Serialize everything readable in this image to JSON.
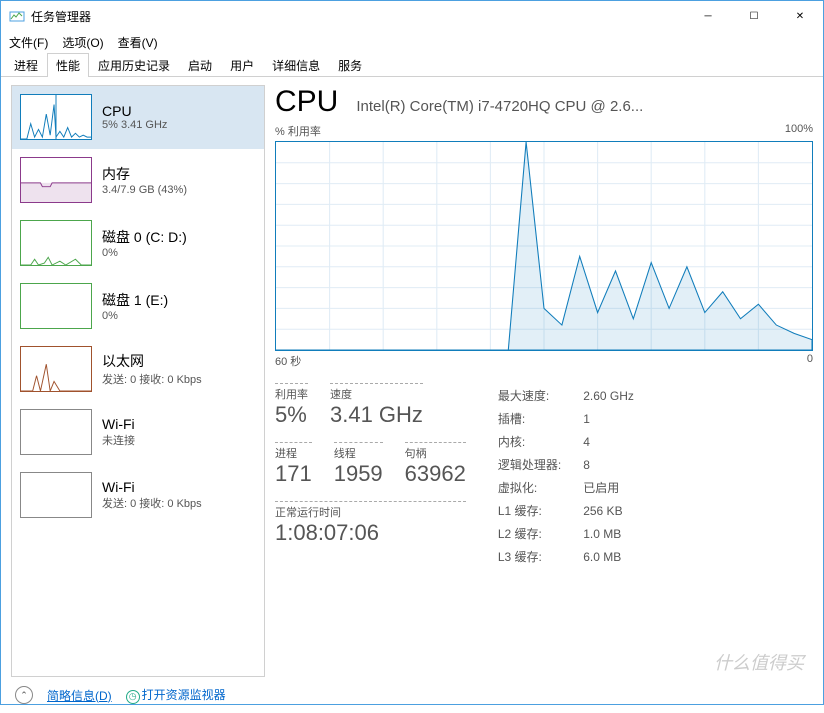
{
  "window": {
    "title": "任务管理器",
    "controls": {
      "min": "─",
      "max": "☐",
      "close": "✕"
    }
  },
  "menu": {
    "file": "文件(F)",
    "options": "选项(O)",
    "view": "查看(V)"
  },
  "tabs": {
    "processes": "进程",
    "performance": "性能",
    "history": "应用历史记录",
    "startup": "启动",
    "users": "用户",
    "details": "详细信息",
    "services": "服务"
  },
  "sidebar": {
    "cpu": {
      "name": "CPU",
      "val": "5%  3.41 GHz"
    },
    "mem": {
      "name": "内存",
      "val": "3.4/7.9 GB (43%)"
    },
    "disk0": {
      "name": "磁盘 0 (C: D:)",
      "val": "0%"
    },
    "disk1": {
      "name": "磁盘 1 (E:)",
      "val": "0%"
    },
    "eth": {
      "name": "以太网",
      "val": "发送: 0 接收: 0 Kbps"
    },
    "wifi1": {
      "name": "Wi-Fi",
      "val": "未连接"
    },
    "wifi2": {
      "name": "Wi-Fi",
      "val": "发送: 0 接收: 0 Kbps"
    }
  },
  "main": {
    "title": "CPU",
    "subtitle": "Intel(R) Core(TM) i7-4720HQ CPU @ 2.6...",
    "util_label": "% 利用率",
    "ymax": "100%",
    "xleft": "60 秒",
    "xright": "0"
  },
  "stats": {
    "util_lbl": "利用率",
    "util_val": "5%",
    "speed_lbl": "速度",
    "speed_val": "3.41 GHz",
    "proc_lbl": "进程",
    "proc_val": "171",
    "thread_lbl": "线程",
    "thread_val": "1959",
    "handle_lbl": "句柄",
    "handle_val": "63962",
    "uptime_lbl": "正常运行时间",
    "uptime_val": "1:08:07:06"
  },
  "details": {
    "maxspeed_lbl": "最大速度:",
    "maxspeed_val": "2.60 GHz",
    "sockets_lbl": "插槽:",
    "sockets_val": "1",
    "cores_lbl": "内核:",
    "cores_val": "4",
    "logical_lbl": "逻辑处理器:",
    "logical_val": "8",
    "virt_lbl": "虚拟化:",
    "virt_val": "已启用",
    "l1_lbl": "L1 缓存:",
    "l1_val": "256 KB",
    "l2_lbl": "L2 缓存:",
    "l2_val": "1.0 MB",
    "l3_lbl": "L3 缓存:",
    "l3_val": "6.0 MB"
  },
  "footer": {
    "brief": "简略信息(D)",
    "monitor": "打开资源监视器"
  },
  "watermark": "什么值得买",
  "chart_data": {
    "type": "line",
    "title": "% 利用率",
    "xlabel": "60 秒",
    "ylabel": "",
    "ylim": [
      0,
      100
    ],
    "x": [
      60,
      58,
      56,
      54,
      52,
      50,
      48,
      46,
      44,
      42,
      40,
      38,
      36,
      34,
      32,
      30,
      28,
      26,
      24,
      22,
      20,
      18,
      16,
      14,
      12,
      10,
      8,
      6,
      4,
      2,
      0
    ],
    "values": [
      0,
      0,
      0,
      0,
      0,
      0,
      0,
      0,
      0,
      0,
      0,
      0,
      0,
      0,
      100,
      20,
      12,
      45,
      18,
      38,
      15,
      42,
      20,
      40,
      18,
      28,
      15,
      22,
      12,
      8,
      5
    ]
  },
  "colors": {
    "cpu": "#117dbb",
    "mem": "#8b3a8b",
    "disk": "#4ca64c",
    "net": "#a0522d",
    "wifi": "#888888"
  }
}
